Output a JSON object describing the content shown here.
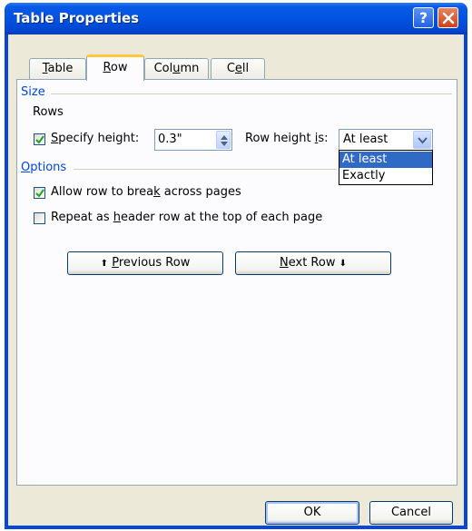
{
  "window": {
    "title": "Table Properties",
    "help_glyph": "?",
    "close_glyph": "close-icon"
  },
  "tabs": [
    {
      "label_pre": "",
      "label_u": "T",
      "label_post": "able"
    },
    {
      "label_pre": "",
      "label_u": "R",
      "label_post": "ow"
    },
    {
      "label_pre": "Col",
      "label_u": "u",
      "label_post": "mn"
    },
    {
      "label_pre": "C",
      "label_u": "e",
      "label_post": "ll"
    }
  ],
  "size_section": {
    "title": "Size",
    "rows_label": "Rows",
    "specify_height": {
      "pre": "",
      "u": "S",
      "post": "pecify height:",
      "checked": true
    },
    "height_value": "0.3\"",
    "row_height_is": {
      "pre": "Row height ",
      "u": "i",
      "post": "s:"
    },
    "row_height_selected": "At least",
    "row_height_options": [
      "At least",
      "Exactly"
    ]
  },
  "options_section": {
    "title_u": "O",
    "title_post": "ptions",
    "allow_break": {
      "pre": "Allow row to brea",
      "u": "k",
      "post": " across pages",
      "checked": true
    },
    "repeat_header": {
      "pre": "Repeat as ",
      "u": "h",
      "post": "eader row at the top of each page",
      "checked": false
    }
  },
  "nav": {
    "prev": {
      "arrow": "⬆",
      "u": "P",
      "post": "revious Row"
    },
    "next": {
      "u": "N",
      "post": "ext Row",
      "arrow": "⬇"
    }
  },
  "footer": {
    "ok": "OK",
    "cancel": "Cancel"
  },
  "colors": {
    "titlebar": "#0053e1",
    "section_label": "#0046d5",
    "selected_option": "#316ac5",
    "active_tab_accent": "#ffc83c"
  }
}
